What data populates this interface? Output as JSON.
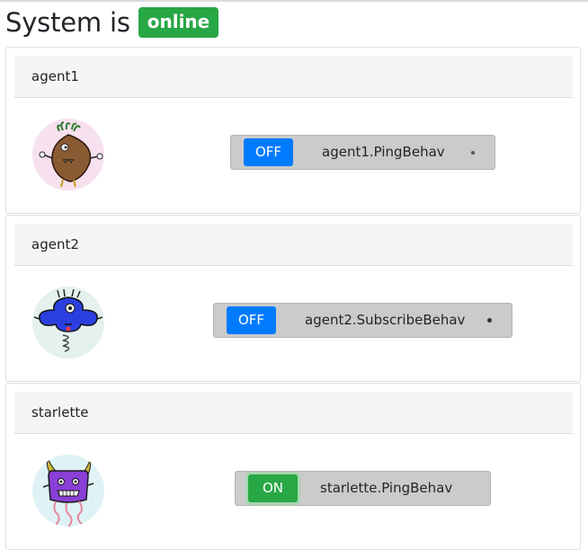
{
  "header": {
    "title": "System is",
    "status": "online",
    "status_color": "#28a745"
  },
  "agents": [
    {
      "name": "agent1",
      "avatar_icon": "brown-monster-avatar",
      "behaviour": {
        "state": "OFF",
        "label": "agent1.PingBehav",
        "state_color": "#007bff"
      }
    },
    {
      "name": "agent2",
      "avatar_icon": "blue-monster-avatar",
      "behaviour": {
        "state": "OFF",
        "label": "agent2.SubscribeBehav",
        "state_color": "#007bff"
      }
    },
    {
      "name": "starlette",
      "avatar_icon": "purple-monster-avatar",
      "behaviour": {
        "state": "ON",
        "label": "starlette.PingBehav",
        "state_color": "#28a745"
      }
    }
  ]
}
